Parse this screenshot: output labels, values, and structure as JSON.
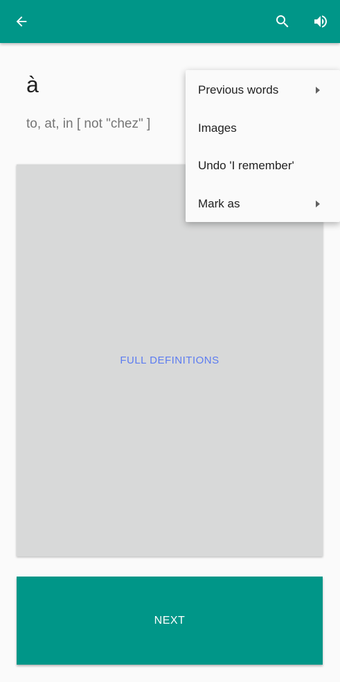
{
  "app_bar": {
    "color": "#009688",
    "icons": [
      "back-arrow-icon",
      "search-icon",
      "volume-icon"
    ]
  },
  "word": {
    "term": "à",
    "meaning": "to, at, in [ not \"chez\" ]"
  },
  "card": {
    "full_definitions_label": "FULL DEFINITIONS"
  },
  "next_button": {
    "label": "NEXT"
  },
  "overflow_menu": {
    "items": [
      {
        "label": "Previous words",
        "has_submenu": true
      },
      {
        "label": "Images",
        "has_submenu": false
      },
      {
        "label": "Undo 'I remember'",
        "has_submenu": false
      },
      {
        "label": "Mark as",
        "has_submenu": true
      }
    ]
  }
}
